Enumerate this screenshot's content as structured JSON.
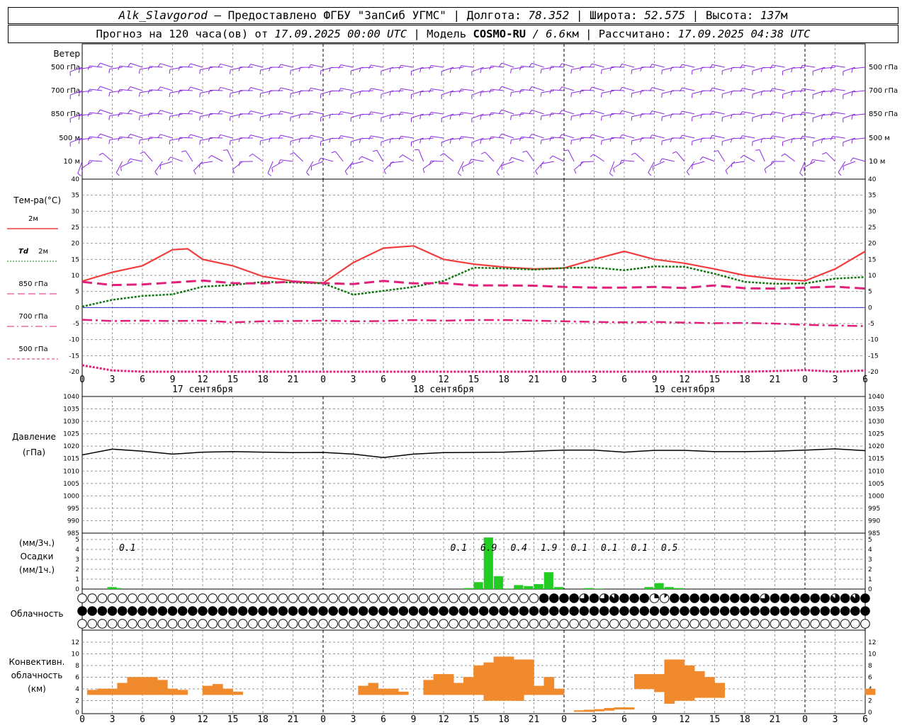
{
  "header": {
    "station": "Alk_Slavgorod",
    "provider": " — Предоставлено ФГБУ \"ЗапСиб УГМС\" | ",
    "lon_label": "Долгота: ",
    "lon": "78.352",
    "lat_label": " | Широта: ",
    "lat": "52.575",
    "alt_label": " | Высота: ",
    "alt": "137",
    "alt_unit": "м",
    "fc_label": "Прогноз на 120 часа(ов) от ",
    "fc_start": "17.09.2025 00:00 UTC",
    "model_label": " | Модель ",
    "model": "COSMO-RU",
    "res": " / 6.6",
    "res_unit": "км",
    "calc_label": " | Рассчитано: ",
    "calc_time": "17.09.2025 04:38 UTC"
  },
  "wind_panel": {
    "title": "Ветер",
    "levels": [
      "500 гПа",
      "700 гПа",
      "850 гПа",
      "500 м",
      "10 м"
    ]
  },
  "temp_panel": {
    "title": "Тем-ра(°С)",
    "legend": [
      {
        "label": "2м",
        "color": "#f03c3c",
        "dash": "none"
      },
      {
        "label_it": "Td",
        "label": "2м",
        "color": "#117711",
        "dash": "dot"
      },
      {
        "label": "850 гПа",
        "color": "#e0207a",
        "dash": "long"
      },
      {
        "label": "700 гПа",
        "color": "#e0207a",
        "dash": "dashdot"
      },
      {
        "label": "500 гПа",
        "color": "#e0207a",
        "dash": "short"
      }
    ]
  },
  "pressure_panel": {
    "title_1": "Давление",
    "title_2": "(гПа)"
  },
  "precip_panel": {
    "title_1": "(мм/3ч.)",
    "title_2": "Осадки",
    "title_3": "(мм/1ч.)"
  },
  "cloud_panel": {
    "title": "Облачность"
  },
  "conv_panel": {
    "title_1": "Конвективн.",
    "title_2": "облачность",
    "title_3": "(км)"
  },
  "dates": [
    "17 сентября",
    "18 сентября",
    "19 сентября"
  ],
  "hour_labels": [
    "0",
    "3",
    "6",
    "9",
    "12",
    "15",
    "18",
    "21",
    "0",
    "3",
    "6",
    "9",
    "12",
    "15",
    "18",
    "21",
    "0",
    "3",
    "6",
    "9",
    "12",
    "15",
    "18",
    "21",
    "0",
    "3",
    "6"
  ],
  "colors": {
    "temp2m": "#f03c3c",
    "dew": "#117711",
    "upper": "#e0207a",
    "precip": "#22cc22",
    "conv": "#f08a2c",
    "wind": "#8a2be2",
    "zero": "#3333cc"
  },
  "chart_data": [
    {
      "type": "line",
      "title": "Тем-ра(°С)",
      "x_unit": "hours since 17.09.2025 00:00 UTC",
      "ylim": [
        -20,
        40
      ],
      "grid": true,
      "series": [
        {
          "name": "2м",
          "x": [
            0,
            3,
            6,
            9,
            10.5,
            12,
            15,
            18,
            21,
            24,
            27,
            30,
            33,
            36,
            39,
            42,
            45,
            48,
            51,
            54,
            57,
            60,
            63,
            66,
            69,
            72,
            75,
            78
          ],
          "y": [
            8.2,
            11,
            13,
            18,
            18.3,
            15,
            13,
            9.7,
            8.2,
            7.6,
            14,
            18.5,
            19.2,
            15,
            13.5,
            12.6,
            12,
            12.3,
            15,
            17.5,
            15,
            13.8,
            12,
            10,
            8.9,
            8.3,
            12,
            17.5
          ]
        },
        {
          "name": "Td 2м",
          "x": [
            0,
            3,
            6,
            9,
            12,
            15,
            18,
            21,
            24,
            27,
            30,
            33,
            36,
            39,
            42,
            45,
            48,
            51,
            54,
            57,
            60,
            63,
            66,
            69,
            72,
            75,
            78
          ],
          "y": [
            0.3,
            2.4,
            3.6,
            4.1,
            6.5,
            7,
            8,
            7.8,
            7.5,
            4,
            5.2,
            6.4,
            8.3,
            12.4,
            12.2,
            11.8,
            12.3,
            12.5,
            11.6,
            12.8,
            12.7,
            10.5,
            8,
            7.4,
            7.5,
            9,
            9.5
          ]
        },
        {
          "name": "850 гПа",
          "x": [
            0,
            3,
            6,
            9,
            12,
            15,
            18,
            21,
            24,
            27,
            30,
            33,
            36,
            39,
            42,
            45,
            48,
            51,
            54,
            57,
            60,
            63,
            66,
            69,
            72,
            75,
            78
          ],
          "y": [
            8.0,
            7,
            7.2,
            7.8,
            8.4,
            7.6,
            7.5,
            8.1,
            7.6,
            7.3,
            8.3,
            7.5,
            7.6,
            6.9,
            6.9,
            6.8,
            6.4,
            6.2,
            6.2,
            6.4,
            6.1,
            6.9,
            6.0,
            5.9,
            6.2,
            6.5,
            5.9
          ]
        },
        {
          "name": "700 гПа",
          "x": [
            0,
            3,
            6,
            9,
            12,
            15,
            18,
            21,
            24,
            27,
            30,
            33,
            36,
            39,
            42,
            45,
            48,
            51,
            54,
            57,
            60,
            63,
            66,
            69,
            72,
            75,
            78
          ],
          "y": [
            -3.8,
            -4.2,
            -4.1,
            -4.2,
            -4.1,
            -4.6,
            -4.3,
            -4.2,
            -4.1,
            -4.3,
            -4.2,
            -3.9,
            -4.1,
            -3.9,
            -3.9,
            -4.1,
            -4.3,
            -4.5,
            -4.6,
            -4.5,
            -4.7,
            -4.9,
            -4.8,
            -5.0,
            -5.4,
            -5.6,
            -5.8
          ]
        },
        {
          "name": "500 гПа",
          "x": [
            0,
            3,
            6,
            9,
            12,
            15,
            18,
            21,
            24,
            27,
            30,
            33,
            36,
            39,
            42,
            45,
            48,
            51,
            54,
            57,
            60,
            63,
            66,
            69,
            72,
            75,
            78
          ],
          "y": [
            -18,
            -19.6,
            -21,
            -21,
            -21,
            -21,
            -21,
            -21,
            -21,
            -21,
            -21,
            -21,
            -21,
            -21,
            -21,
            -21,
            -21,
            -21,
            -21,
            -21,
            -21,
            -21,
            -21,
            -19.8,
            -19.5,
            -20,
            -19.6
          ]
        }
      ]
    },
    {
      "type": "line",
      "title": "Давление",
      "ylabel": "(гПа)",
      "x_unit": "hours since 17.09.2025 00:00 UTC",
      "ylim": [
        985,
        1040
      ],
      "grid": true,
      "series": [
        {
          "name": "Давление",
          "x": [
            0,
            3,
            6,
            9,
            12,
            15,
            18,
            21,
            24,
            27,
            30,
            33,
            36,
            39,
            42,
            45,
            48,
            51,
            54,
            57,
            60,
            63,
            66,
            69,
            72,
            75,
            78
          ],
          "y": [
            1016.5,
            1018.8,
            1018,
            1016.8,
            1017.6,
            1017.8,
            1017.6,
            1017.4,
            1017.5,
            1016.8,
            1015.4,
            1016.8,
            1017.4,
            1017.5,
            1017.6,
            1018,
            1018.4,
            1018.4,
            1017.6,
            1018.3,
            1018.3,
            1017.8,
            1017.8,
            1018,
            1018.4,
            1018.9,
            1018.2
          ]
        }
      ]
    },
    {
      "type": "bar",
      "title": "Осадки",
      "ylabel": "(мм/1ч.)",
      "x_unit": "hours since 17.09.2025 00:00 UTC",
      "ylim": [
        0,
        5
      ],
      "grid": true,
      "series": [
        {
          "name": "мм/1ч",
          "x": [
            3,
            3.5,
            38.5,
            39.5,
            40.5,
            41.5,
            42.5,
            43.5,
            44.5,
            45.5,
            46.5,
            47.5,
            50.5,
            51.5,
            56.5,
            57.5,
            58.5,
            59.5
          ],
          "values": [
            0.2,
            0.1,
            0.1,
            0.7,
            5.2,
            1.3,
            0.05,
            0.4,
            0.3,
            0.5,
            1.7,
            0.2,
            0.1,
            0.05,
            0.2,
            0.6,
            0.2,
            0.1
          ]
        }
      ],
      "labels_3h": [
        {
          "x": 4.5,
          "text": "0.1"
        },
        {
          "x": 37.5,
          "text": "0.1"
        },
        {
          "x": 40.5,
          "text": "6.9"
        },
        {
          "x": 43.5,
          "text": "0.4"
        },
        {
          "x": 46.5,
          "text": "1.9"
        },
        {
          "x": 49.5,
          "text": "0.1"
        },
        {
          "x": 52.5,
          "text": "0.1"
        },
        {
          "x": 55.5,
          "text": "0.1"
        },
        {
          "x": 58.5,
          "text": "0.5"
        }
      ]
    },
    {
      "type": "heatmap",
      "title": "Облачность",
      "x_unit": "hours since 17.09.2025 00:00 UTC (one column per hour, 0..78)",
      "rows_note": "fraction of sky covered in octas 0..8, three levels: high, middle, low",
      "high": "0000000000000000000000000000000000000000000000888868678882188888888868888887878888888883182888880000000008888880000000000000",
      "middle": "8888888888888888888888888888888888888888888888888888888888888888888888888888888888880000000000000000000000000000000000000000",
      "low": "0000000000000000000000000000000000000000000000000000000000000000000000000000000000000000000000000000000000000000000000000000"
    },
    {
      "type": "bar",
      "title": "Конвективн. облачность",
      "ylabel": "(км)",
      "x_unit": "hours since 17.09.2025 00:00 UTC",
      "ylim": [
        0,
        13
      ],
      "grid": true,
      "series": [
        {
          "name": "основание/вершина",
          "x": [
            1,
            2,
            3,
            4,
            5,
            6,
            7,
            8,
            9,
            10,
            12.5,
            13.5,
            14.5,
            15.5,
            28,
            29,
            30,
            31,
            32,
            34.5,
            35.5,
            36.5,
            37.5,
            38.5,
            39.5,
            40.5,
            41.5,
            42.5,
            43.5,
            44.5,
            45.5,
            46.5,
            47.5,
            49.5,
            50.5,
            51.5,
            52.5,
            53.5,
            54.5,
            55.5,
            56.5,
            57.5,
            58.5,
            59.5,
            60.5,
            61.5,
            62.5,
            63.5,
            78.5
          ],
          "base": [
            3,
            3,
            3,
            3,
            3,
            3,
            3,
            3,
            3,
            3,
            3,
            3,
            3,
            3,
            3,
            3,
            3,
            3,
            3,
            3,
            3,
            3,
            3,
            3,
            3,
            2,
            2,
            2,
            2,
            3,
            3,
            3,
            3,
            0.1,
            0.1,
            0.2,
            0.3,
            0.5,
            0.5,
            4,
            4,
            3.5,
            1.5,
            2,
            2,
            2.5,
            2.5,
            2.5,
            3
          ],
          "top": [
            3.8,
            4,
            4,
            5,
            6,
            6,
            6,
            5.5,
            4,
            3.8,
            4.5,
            4.8,
            4,
            3.5,
            4.5,
            5,
            4,
            4,
            3.5,
            5.5,
            6.5,
            6.5,
            5,
            6,
            8,
            8.5,
            9.5,
            9.5,
            9,
            9,
            4.5,
            6,
            4,
            0.3,
            0.4,
            0.5,
            0.7,
            0.8,
            0.8,
            6.5,
            6.5,
            6.5,
            9,
            9,
            8,
            7,
            6,
            5,
            4
          ]
        }
      ]
    }
  ]
}
